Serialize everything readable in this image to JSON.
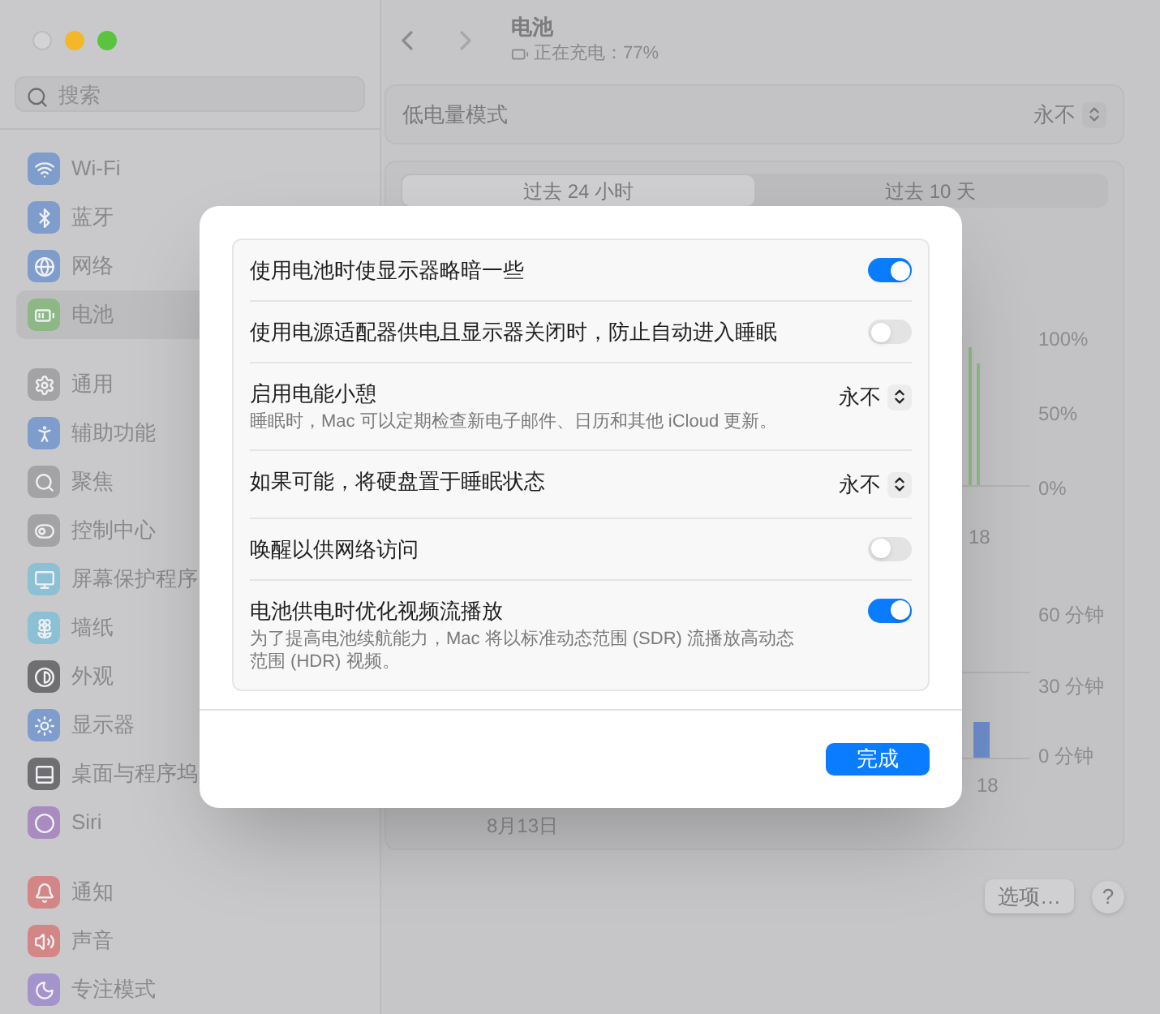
{
  "sidebar": {
    "search": {
      "placeholder": "搜索"
    },
    "groups": [
      [
        {
          "label": "Wi-Fi",
          "selected": false
        },
        {
          "label": "蓝牙",
          "selected": false
        },
        {
          "label": "网络",
          "selected": false
        },
        {
          "label": "电池",
          "selected": true
        }
      ],
      [
        {
          "label": "通用",
          "selected": false
        },
        {
          "label": "辅助功能",
          "selected": false
        },
        {
          "label": "聚焦",
          "selected": false
        },
        {
          "label": "控制中心",
          "selected": false
        },
        {
          "label": "屏幕保护程序",
          "selected": false
        },
        {
          "label": "墙纸",
          "selected": false
        },
        {
          "label": "外观",
          "selected": false
        },
        {
          "label": "显示器",
          "selected": false
        },
        {
          "label": "桌面与程序坞",
          "selected": false
        },
        {
          "label": "Siri",
          "selected": false
        }
      ],
      [
        {
          "label": "通知",
          "selected": false
        },
        {
          "label": "声音",
          "selected": false
        },
        {
          "label": "专注模式",
          "selected": false
        }
      ]
    ]
  },
  "header": {
    "title": "电池",
    "subtitle": "正在充电：77%"
  },
  "low_power_mode": {
    "label": "低电量模式",
    "value": "永不"
  },
  "range_tabs": [
    {
      "label": "过去 24 小时",
      "selected": true
    },
    {
      "label": "过去 10 天",
      "selected": false
    }
  ],
  "background_charts": [
    {
      "y_labels": [
        "100%",
        "50%",
        "0%"
      ],
      "x_labels": [
        "18"
      ]
    },
    {
      "y_labels": [
        "60 分钟",
        "30 分钟",
        "0 分钟"
      ],
      "x_labels": [
        "18"
      ],
      "date": "8月13日"
    }
  ],
  "footer_buttons": {
    "options": "选项…",
    "help": "?"
  },
  "dialog": {
    "rows": [
      {
        "kind": "toggle",
        "label": "使用电池时使显示器略暗一些",
        "on": true
      },
      {
        "kind": "toggle",
        "label": "使用电源适配器供电且显示器关闭时，防止自动进入睡眠",
        "on": false
      },
      {
        "kind": "popup",
        "label": "启用电能小憩",
        "description": "睡眠时，Mac 可以定期检查新电子邮件、日历和其他 iCloud 更新。",
        "value": "永不"
      },
      {
        "kind": "popup",
        "label": "如果可能，将硬盘置于睡眠状态",
        "value": "永不"
      },
      {
        "kind": "toggle",
        "label": "唤醒以供网络访问",
        "on": false
      },
      {
        "kind": "toggle",
        "label": "电池供电时优化视频流播放",
        "description": "为了提高电池续航能力，Mac 将以标准动态范围 (SDR) 流播放高动态范围 (HDR) 视频。",
        "on": true
      }
    ],
    "done": "完成"
  }
}
